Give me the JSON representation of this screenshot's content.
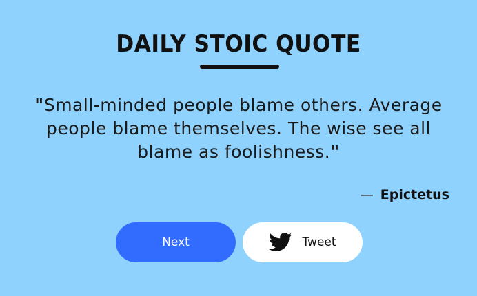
{
  "header": {
    "title": "DAILY STOIC QUOTE"
  },
  "quote": {
    "open_mark": "\"",
    "text": "Small-minded people blame others. Average people blame themselves. The wise see all blame as foolishness.",
    "close_mark": "\"",
    "dash": "—",
    "author": "Epictetus"
  },
  "actions": {
    "next_label": "Next",
    "tweet_label": "Tweet",
    "tweet_icon": "twitter-bird-icon"
  },
  "colors": {
    "background": "#8fd2fd",
    "next_button": "#326cff",
    "tweet_button": "#ffffff",
    "text": "#111111"
  }
}
